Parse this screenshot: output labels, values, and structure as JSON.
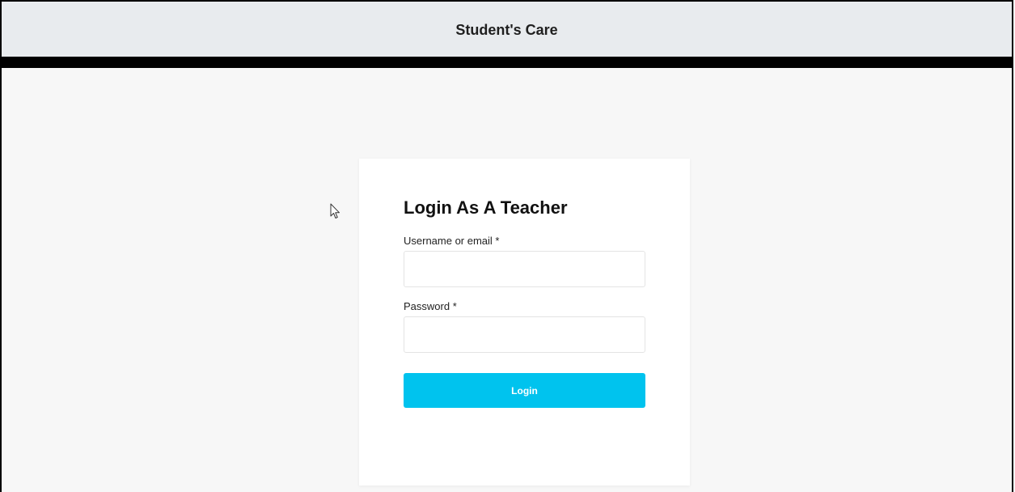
{
  "header": {
    "title": "Student's Care"
  },
  "login_form": {
    "title": "Login As A Teacher",
    "username_label": "Username or email *",
    "username_value": "",
    "password_label": "Password *",
    "password_value": "",
    "submit_label": "Login"
  },
  "colors": {
    "header_bg": "#e8ebee",
    "divider_bar": "#000000",
    "page_bg": "#f7f7f7",
    "card_bg": "#ffffff",
    "button_bg": "#00c3ee",
    "button_text": "#ffffff"
  },
  "icons": {
    "cursor": "mouse-pointer-icon"
  }
}
